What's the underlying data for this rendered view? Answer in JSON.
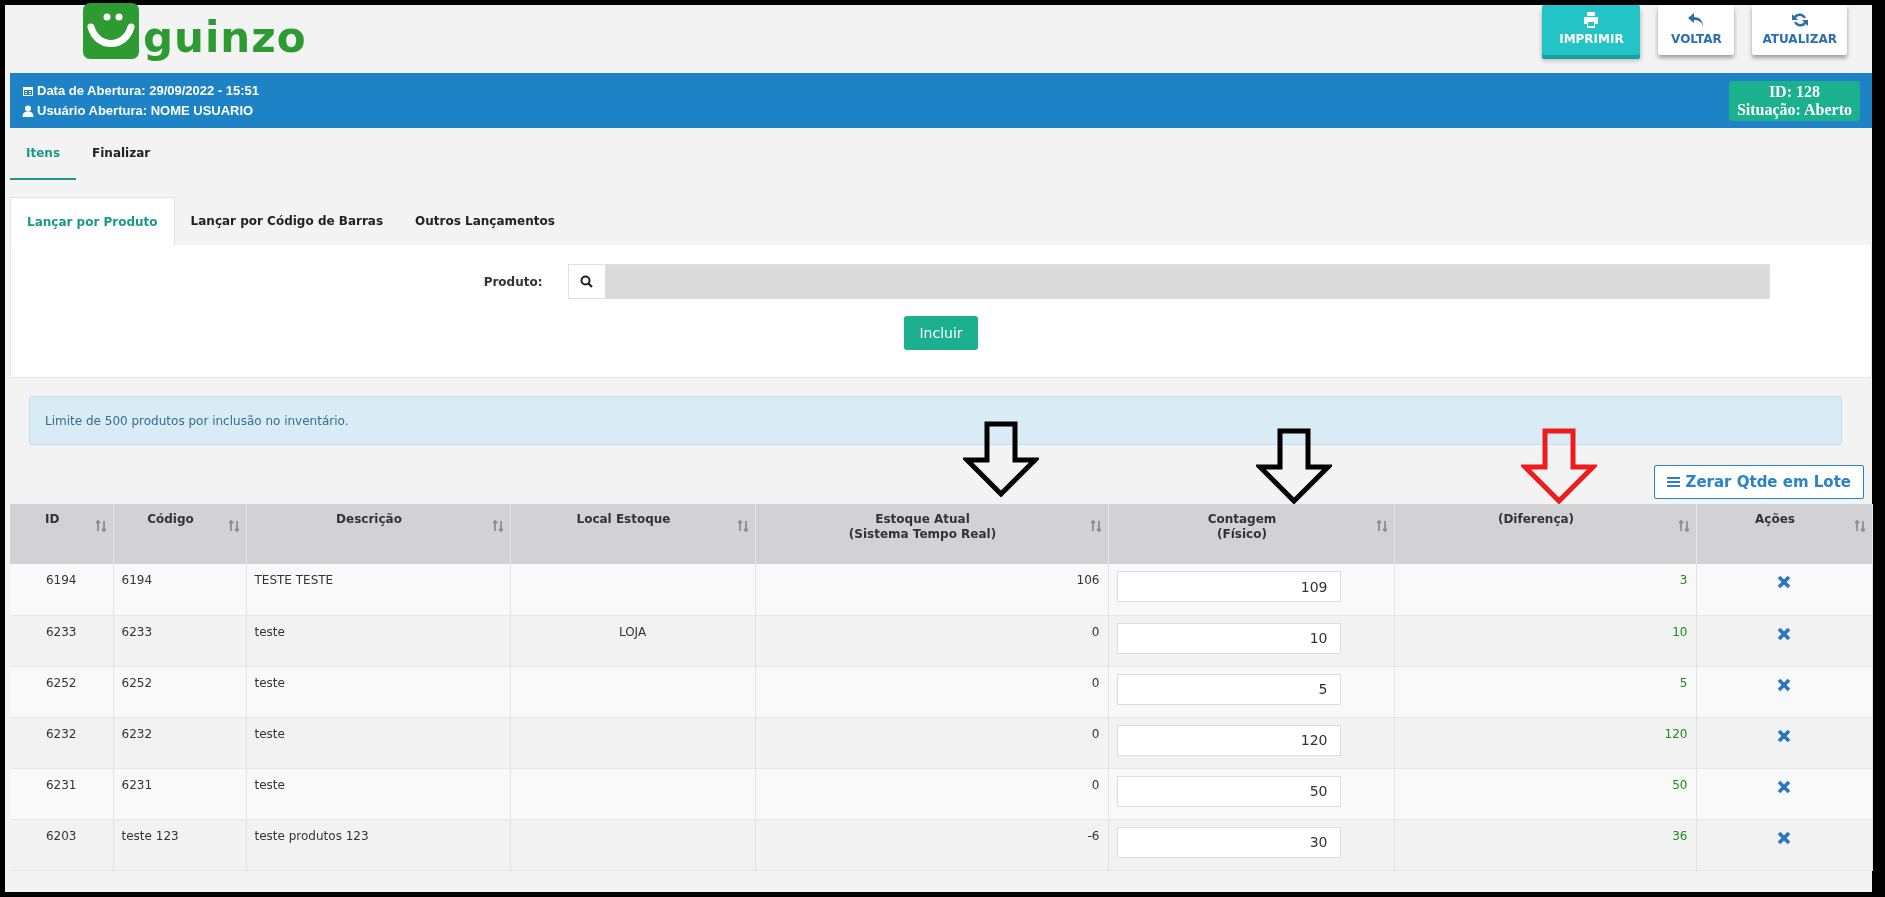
{
  "logo": {
    "text": "guinzo"
  },
  "toolbar": [
    {
      "kind": "print",
      "label": "IMPRIMIR",
      "selected": true
    },
    {
      "kind": "back",
      "label": "VOLTAR",
      "selected": false
    },
    {
      "kind": "refresh",
      "label": "ATUALIZAR",
      "selected": false
    }
  ],
  "info_bar": {
    "opened": "Data de Abertura: 29/09/2022 - 15:51",
    "user": "Usuário Abertura: NOME USUARIO",
    "id": "ID: 128",
    "status": "Situação: Aberto"
  },
  "tabs": [
    {
      "label": "Itens",
      "selected": true
    },
    {
      "label": "Finalizar",
      "selected": false
    }
  ],
  "subtabs": [
    {
      "label": "Lançar por Produto",
      "selected": true
    },
    {
      "label": "Lançar por Código de Barras",
      "selected": false
    },
    {
      "label": "Outros Lançamentos",
      "selected": false
    }
  ],
  "form": {
    "label": "Produto:",
    "button": "Incluir"
  },
  "alert": "Limite de 500 produtos por inclusão no inventário.",
  "batch_button": "Zerar Qtde em Lote",
  "table": {
    "columns": [
      [
        "ID"
      ],
      [
        "Código"
      ],
      [
        "Descrição"
      ],
      [
        "Local Estoque"
      ],
      [
        "Estoque Atual",
        "(Sistema Tempo Real)"
      ],
      [
        "Contagem",
        "(Físico)"
      ],
      [
        "(Diferença)"
      ],
      [
        "Ações"
      ]
    ],
    "rows": [
      {
        "id": "6194",
        "code": "6194",
        "description": "TESTE TESTE",
        "location": "",
        "stock": "106",
        "count": "109",
        "difference": "3"
      },
      {
        "id": "6233",
        "code": "6233",
        "description": "teste",
        "location": "LOJA",
        "stock": "0",
        "count": "10",
        "difference": "10"
      },
      {
        "id": "6252",
        "code": "6252",
        "description": "teste",
        "location": "",
        "stock": "0",
        "count": "5",
        "difference": "5"
      },
      {
        "id": "6232",
        "code": "6232",
        "description": "teste",
        "location": "",
        "stock": "0",
        "count": "120",
        "difference": "120"
      },
      {
        "id": "6231",
        "code": "6231",
        "description": "teste",
        "location": "",
        "stock": "0",
        "count": "50",
        "difference": "50"
      },
      {
        "id": "6203",
        "code": "teste 123",
        "description": "teste produtos 123",
        "location": "",
        "stock": "-6",
        "count": "30",
        "difference": "36"
      }
    ]
  },
  "annotations": [
    {
      "color": "#000000"
    },
    {
      "color": "#000000"
    },
    {
      "color": "#ee1c1c"
    }
  ]
}
